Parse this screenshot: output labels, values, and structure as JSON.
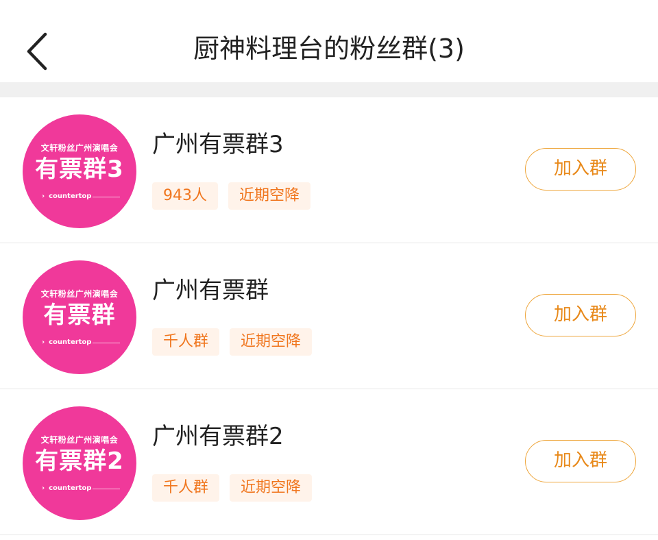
{
  "header": {
    "title": "厨神料理台的粉丝群(3)",
    "back_icon": "chevron-left-icon"
  },
  "colors": {
    "accent": "#e8891a",
    "tag_bg": "#fff3ea",
    "avatar_bg": "#f0399a"
  },
  "groups": [
    {
      "name": "广州有票群3",
      "avatar": {
        "top_text": "文轩粉丝广州演唱会",
        "main_text": "有票群3",
        "brand": "countertop"
      },
      "tags": [
        "943人",
        "近期空降"
      ],
      "join_label": "加入群"
    },
    {
      "name": "广州有票群",
      "avatar": {
        "top_text": "文轩粉丝广州演唱会",
        "main_text": "有票群",
        "brand": "countertop"
      },
      "tags": [
        "千人群",
        "近期空降"
      ],
      "join_label": "加入群"
    },
    {
      "name": "广州有票群2",
      "avatar": {
        "top_text": "文轩粉丝广州演唱会",
        "main_text": "有票群2",
        "brand": "countertop"
      },
      "tags": [
        "千人群",
        "近期空降"
      ],
      "join_label": "加入群"
    }
  ]
}
